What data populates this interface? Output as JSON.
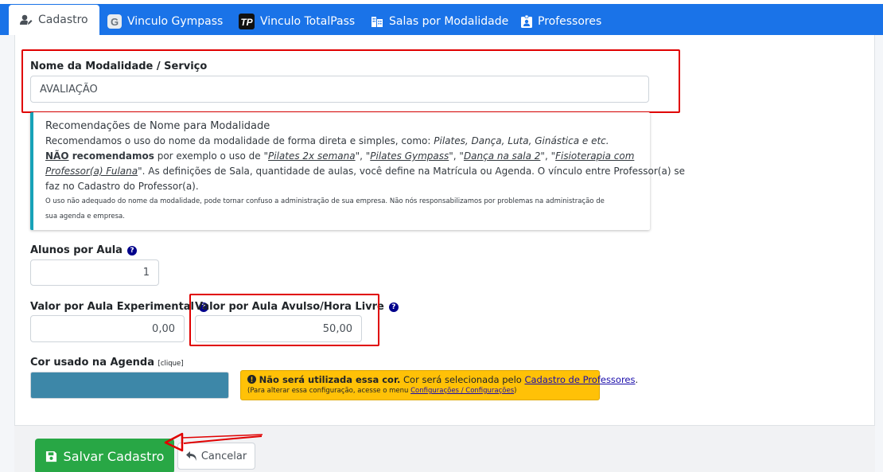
{
  "tabs": [
    {
      "label": "Cadastro",
      "icon": "user-edit-icon",
      "active": true
    },
    {
      "label": "Vinculo Gympass",
      "icon": "gympass-logo-icon"
    },
    {
      "label": "Vinculo TotalPass",
      "icon": "totalpass-logo-icon"
    },
    {
      "label": "Salas por Modalidade",
      "icon": "building-icon"
    },
    {
      "label": "Professores",
      "icon": "id-badge-icon"
    }
  ],
  "form": {
    "nome_label": "Nome da Modalidade / Serviço",
    "nome_value": "AVALIAÇÃO",
    "alunos_label": "Alunos por Aula",
    "alunos_value": "1",
    "valor_exp_label": "Valor por Aula Experimental",
    "valor_exp_value": "0,00",
    "valor_avulso_label": "Valor por Aula Avulso/Hora Livre",
    "valor_avulso_value": "50,00",
    "cor_label": "Cor usado na Agenda",
    "cor_hint": "[clique]",
    "cor_value": "#3d87a8"
  },
  "recommendation": {
    "title": "Recomendações de Nome para Modalidade",
    "line1_text": "Recomendamos o uso do nome da modalidade de forma direta e simples, como: ",
    "line1_examples": "Pilates, Dança, Luta, Ginástica e etc.",
    "nao": "NÃO",
    "recomendamos": " recomendamos",
    "line2_text": " por exemplo o uso de \"",
    "ex1": "Pilates 2x semana",
    "sep1": "\", \"",
    "ex2": "Pilates Gympass",
    "sep2": "\", \"",
    "ex3": "Dança na sala 2",
    "sep3": "\", \"",
    "ex4a": "Fisioterapia com",
    "ex4b": "Professor(a) Fulana",
    "line3_text": "\". As definições de Sala, quantidade de aulas, você define na Matrícula ou Agenda. O vínculo entre Professor(a) se",
    "line4_text": "faz no Cadastro do Professor(a).",
    "small1": "O uso não adequado do nome da modalidade, pode tornar confuso a administração de sua empresa. Não nós responsabilizamos por problemas na administração de",
    "small2": "sua agenda e empresa."
  },
  "warning": {
    "bold": "Não será utilizada essa cor.",
    "text": " Cor será selecionada pelo ",
    "link": "Cadastro de Professores",
    "end": ".",
    "small_text": "(Para alterar essa configuração, acesse o menu ",
    "small_link": "Configurações / Configurações",
    "small_end": ")"
  },
  "buttons": {
    "save": "Salvar Cadastro",
    "cancel": "Cancelar"
  },
  "colors": {
    "tab_bar": "#1a73e8",
    "save_button": "#28a745",
    "highlight": "#e00000",
    "callout_border": "#17a2b8",
    "warning": "#ffc107"
  }
}
